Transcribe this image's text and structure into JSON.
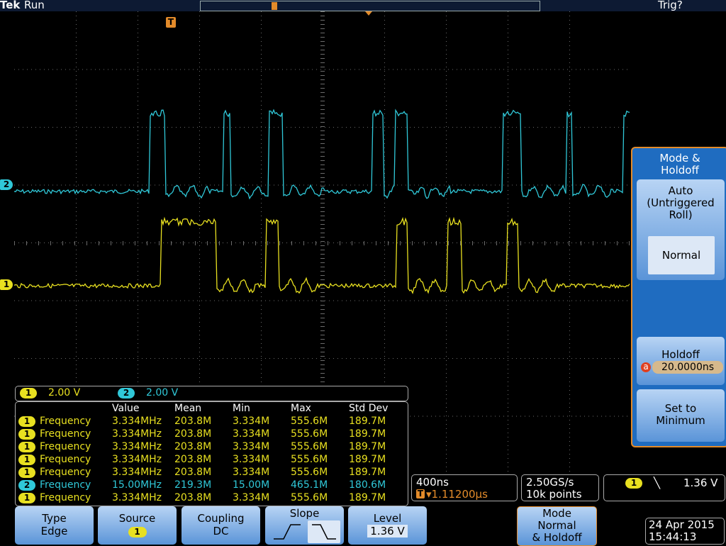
{
  "topbar": {
    "brand": "Tek",
    "state": "Run",
    "trigger_status": "Trig?"
  },
  "channels": {
    "ch1": {
      "label": "1",
      "scale": "2.00 V",
      "color": "#e8e020"
    },
    "ch2": {
      "label": "2",
      "scale": "2.00 V",
      "color": "#30c8d8"
    }
  },
  "trigger_marker": "T",
  "measurements": {
    "headers": [
      "Value",
      "Mean",
      "Min",
      "Max",
      "Std Dev"
    ],
    "rows": [
      {
        "ch": "1",
        "name": "Frequency",
        "value": "3.334MHz",
        "mean": "203.8M",
        "min": "3.334M",
        "max": "555.6M",
        "std": "189.7M"
      },
      {
        "ch": "1",
        "name": "Frequency",
        "value": "3.334MHz",
        "mean": "203.8M",
        "min": "3.334M",
        "max": "555.6M",
        "std": "189.7M"
      },
      {
        "ch": "1",
        "name": "Frequency",
        "value": "3.334MHz",
        "mean": "203.8M",
        "min": "3.334M",
        "max": "555.6M",
        "std": "189.7M"
      },
      {
        "ch": "1",
        "name": "Frequency",
        "value": "3.334MHz",
        "mean": "203.8M",
        "min": "3.334M",
        "max": "555.6M",
        "std": "189.7M"
      },
      {
        "ch": "1",
        "name": "Frequency",
        "value": "3.334MHz",
        "mean": "203.8M",
        "min": "3.334M",
        "max": "555.6M",
        "std": "189.7M"
      },
      {
        "ch": "2",
        "name": "Frequency",
        "value": "15.00MHz",
        "mean": "219.3M",
        "min": "15.00M",
        "max": "465.1M",
        "std": "180.6M"
      },
      {
        "ch": "1",
        "name": "Frequency",
        "value": "3.334MHz",
        "mean": "203.8M",
        "min": "3.334M",
        "max": "555.6M",
        "std": "189.7M"
      }
    ]
  },
  "horizontal": {
    "timebase": "400ns",
    "position": "▾1.11200µs",
    "sample_rate": "2.50GS/s",
    "record": "10k points"
  },
  "trigger_readout": {
    "source": "1",
    "slope_symbol": "╲",
    "level": "1.36 V"
  },
  "side_menu": {
    "title_line1": "Mode &",
    "title_line2": "Holdoff",
    "auto_line1": "Auto",
    "auto_line2": "(Untriggered",
    "auto_line3": "Roll)",
    "normal": "Normal",
    "holdoff_label": "Holdoff",
    "holdoff_knob": "a",
    "holdoff_value": "20.0000ns",
    "set_min_line1": "Set to",
    "set_min_line2": "Minimum"
  },
  "bottom_menu": {
    "type_label": "Type",
    "type_value": "Edge",
    "source_label": "Source",
    "source_value": "1",
    "coupling_label": "Coupling",
    "coupling_value": "DC",
    "slope_label": "Slope",
    "level_label": "Level",
    "level_value": "1.36 V",
    "mode_line1": "Mode",
    "mode_line2": "Normal",
    "mode_line3": "& Holdoff"
  },
  "datetime": {
    "date": "24 Apr 2015",
    "time": "15:44:13"
  }
}
